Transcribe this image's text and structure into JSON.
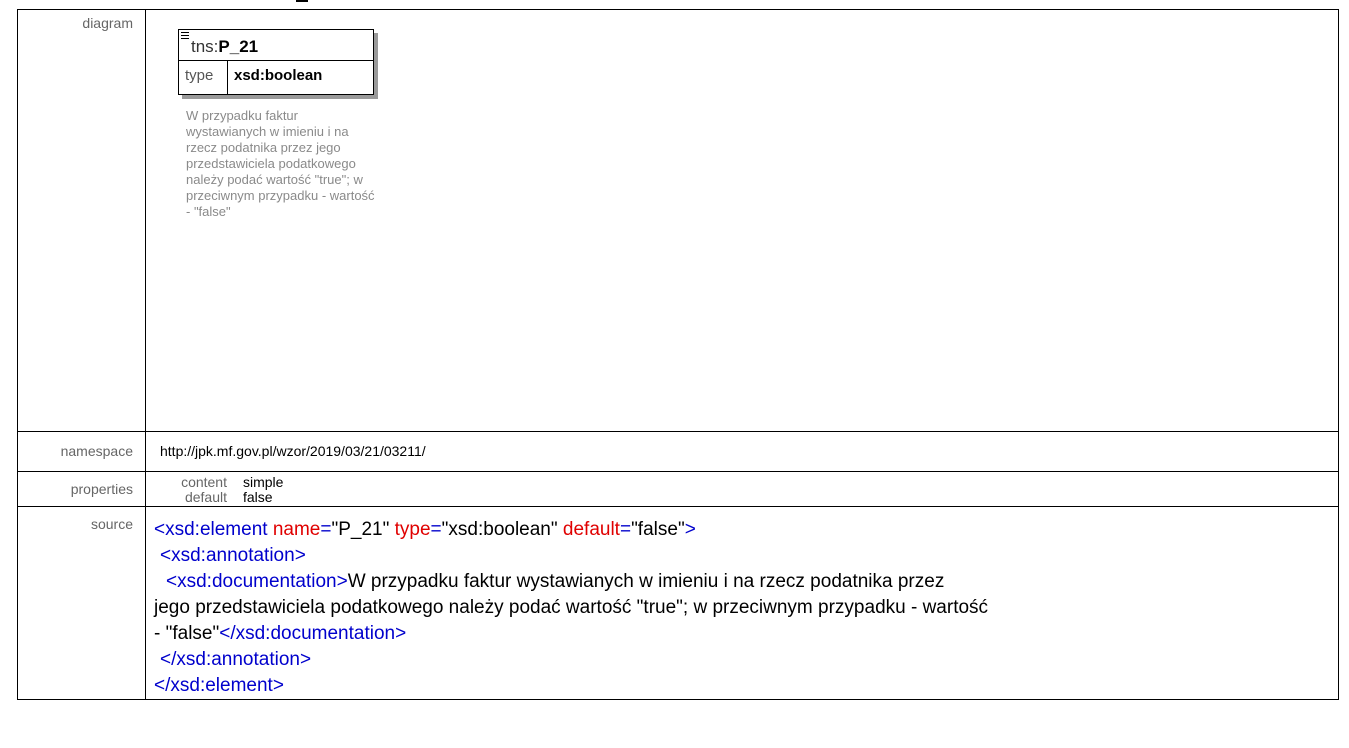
{
  "rows": {
    "diagram_label": "diagram",
    "namespace_label": "namespace",
    "properties_label": "properties",
    "source_label": "source"
  },
  "diagram": {
    "prefix": "tns:",
    "name": "P_21",
    "type_key": "type",
    "type_value": "xsd:boolean",
    "documentation": "W przypadku faktur\nwystawianych w imieniu i na\nrzecz podatnika przez jego\nprzedstawiciela podatkowego\nnależy podać wartość \"true\"; w\nprzeciwnym przypadku - wartość\n- \"false\""
  },
  "namespace": "http://jpk.mf.gov.pl/wzor/2019/03/21/03211/",
  "properties": {
    "content_key": "content",
    "content_value": "simple",
    "default_key": "default",
    "default_value": "false"
  },
  "source": {
    "open_tag": "<xsd:element",
    "attr_name_key": "name",
    "attr_name_val": "\"P_21\"",
    "attr_type_key": "type",
    "attr_type_val": "\"xsd:boolean\"",
    "attr_default_key": "default",
    "attr_default_val": "\"false\"",
    "close_bracket": ">",
    "eq": "=",
    "annotation_open": "<xsd:annotation>",
    "documentation_open": "<xsd:documentation>",
    "documentation_text_1": "W przypadku faktur wystawianych w imieniu i na rzecz podatnika przez",
    "documentation_text_2": "jego przedstawiciela podatkowego należy podać wartość \"true\"; w przeciwnym przypadku - wartość",
    "documentation_text_3": "- \"false\"",
    "documentation_close": "</xsd:documentation>",
    "annotation_close": "</xsd:annotation>",
    "element_close": "</xsd:element>"
  }
}
